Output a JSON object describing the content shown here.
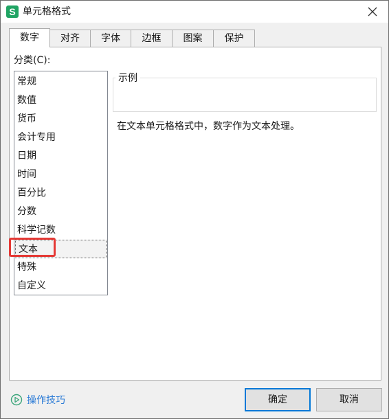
{
  "window": {
    "app_icon_letter": "S",
    "title": "单元格格式"
  },
  "tabs": [
    {
      "label": "数字",
      "active": true
    },
    {
      "label": "对齐"
    },
    {
      "label": "字体"
    },
    {
      "label": "边框"
    },
    {
      "label": "图案"
    },
    {
      "label": "保护"
    }
  ],
  "category": {
    "label": "分类(C):",
    "items": [
      "常规",
      "数值",
      "货币",
      "会计专用",
      "日期",
      "时间",
      "百分比",
      "分数",
      "科学记数",
      "文本",
      "特殊",
      "自定义"
    ],
    "selected": "文本"
  },
  "sample": {
    "legend": "示例",
    "value": ""
  },
  "description": "在文本单元格格式中，数字作为文本处理。",
  "footer": {
    "tips_label": "操作技巧",
    "ok_label": "确定",
    "cancel_label": "取消"
  },
  "colors": {
    "accent": "#0078d7",
    "link": "#2b7bd6",
    "highlight": "#e53935",
    "app_icon": "#1fa463"
  }
}
